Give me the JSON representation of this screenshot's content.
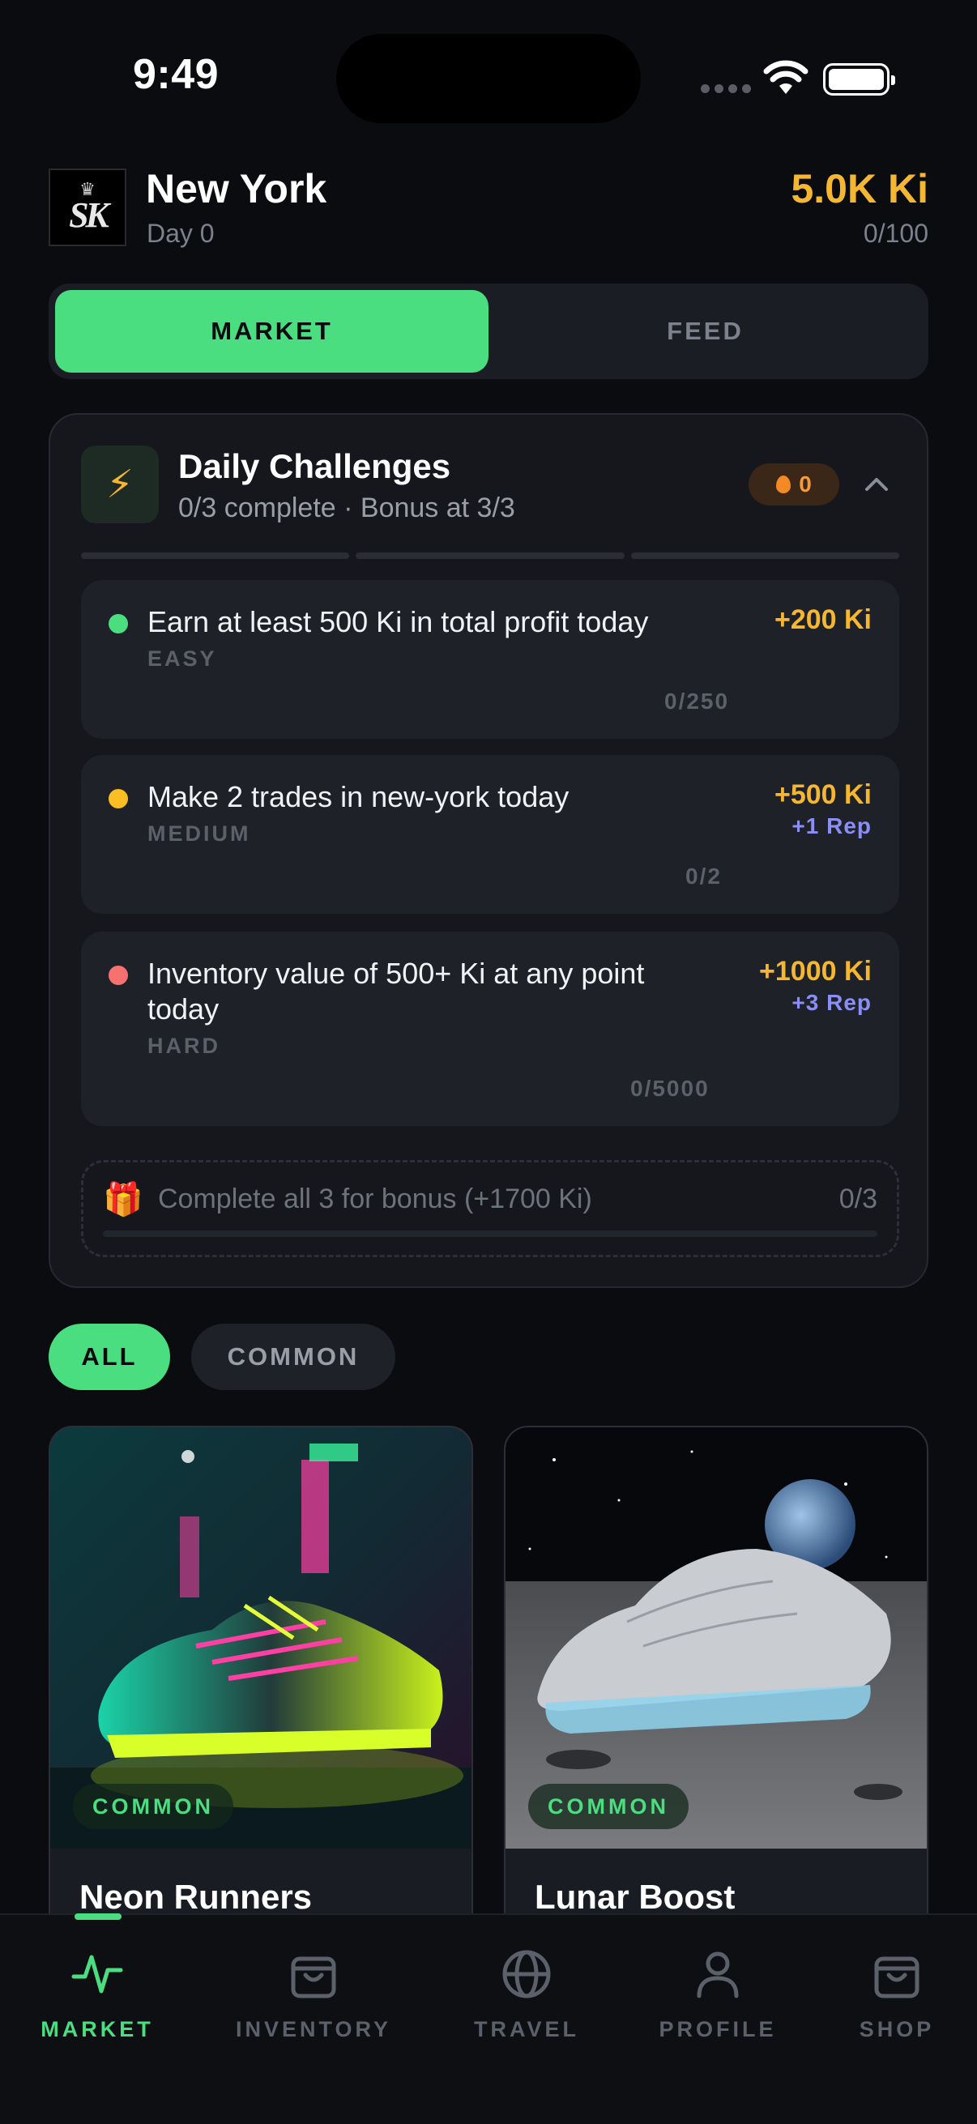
{
  "status_bar": {
    "time": "9:49"
  },
  "header": {
    "logo_text": "SK",
    "city": "New York",
    "day": "Day 0",
    "balance": "5.0K Ki",
    "capacity": "0/100"
  },
  "segment": {
    "market_label": "MARKET",
    "feed_label": "FEED",
    "active": "MARKET"
  },
  "challenges": {
    "title": "Daily Challenges",
    "subtitle": "0/3 complete · Bonus at 3/3",
    "streak": "0",
    "items": [
      {
        "text": "Earn at least 500 Ki in total profit today",
        "difficulty": "EASY",
        "reward": "+200 Ki",
        "rep": "",
        "progress": "0/250",
        "color": "#4ade80"
      },
      {
        "text": "Make 2 trades in new-york today",
        "difficulty": "MEDIUM",
        "reward": "+500 Ki",
        "rep": "+1 Rep",
        "progress": "0/2",
        "color": "#fbbf24"
      },
      {
        "text": "Inventory value of 500+ Ki at any point today",
        "difficulty": "HARD",
        "reward": "+1000 Ki",
        "rep": "+3 Rep",
        "progress": "0/5000",
        "color": "#f87171"
      }
    ],
    "bonus": {
      "label": "Complete all 3 for bonus (+1700 Ki)",
      "count": "0/3"
    }
  },
  "filters": {
    "all": "ALL",
    "common": "COMMON"
  },
  "products": [
    {
      "name": "Neon Runners",
      "rarity": "COMMON"
    },
    {
      "name": "Lunar Boost",
      "rarity": "COMMON"
    }
  ],
  "tabbar": {
    "items": [
      {
        "label": "MARKET",
        "icon": "pulse-icon"
      },
      {
        "label": "INVENTORY",
        "icon": "bag-icon"
      },
      {
        "label": "TRAVEL",
        "icon": "globe-icon"
      },
      {
        "label": "PROFILE",
        "icon": "person-icon"
      },
      {
        "label": "SHOP",
        "icon": "bag-icon"
      }
    ],
    "active": "MARKET"
  },
  "colors": {
    "accent": "#4ade80",
    "gold": "#f5b731",
    "rep": "#8b8ff5",
    "background": "#0b0c10"
  }
}
